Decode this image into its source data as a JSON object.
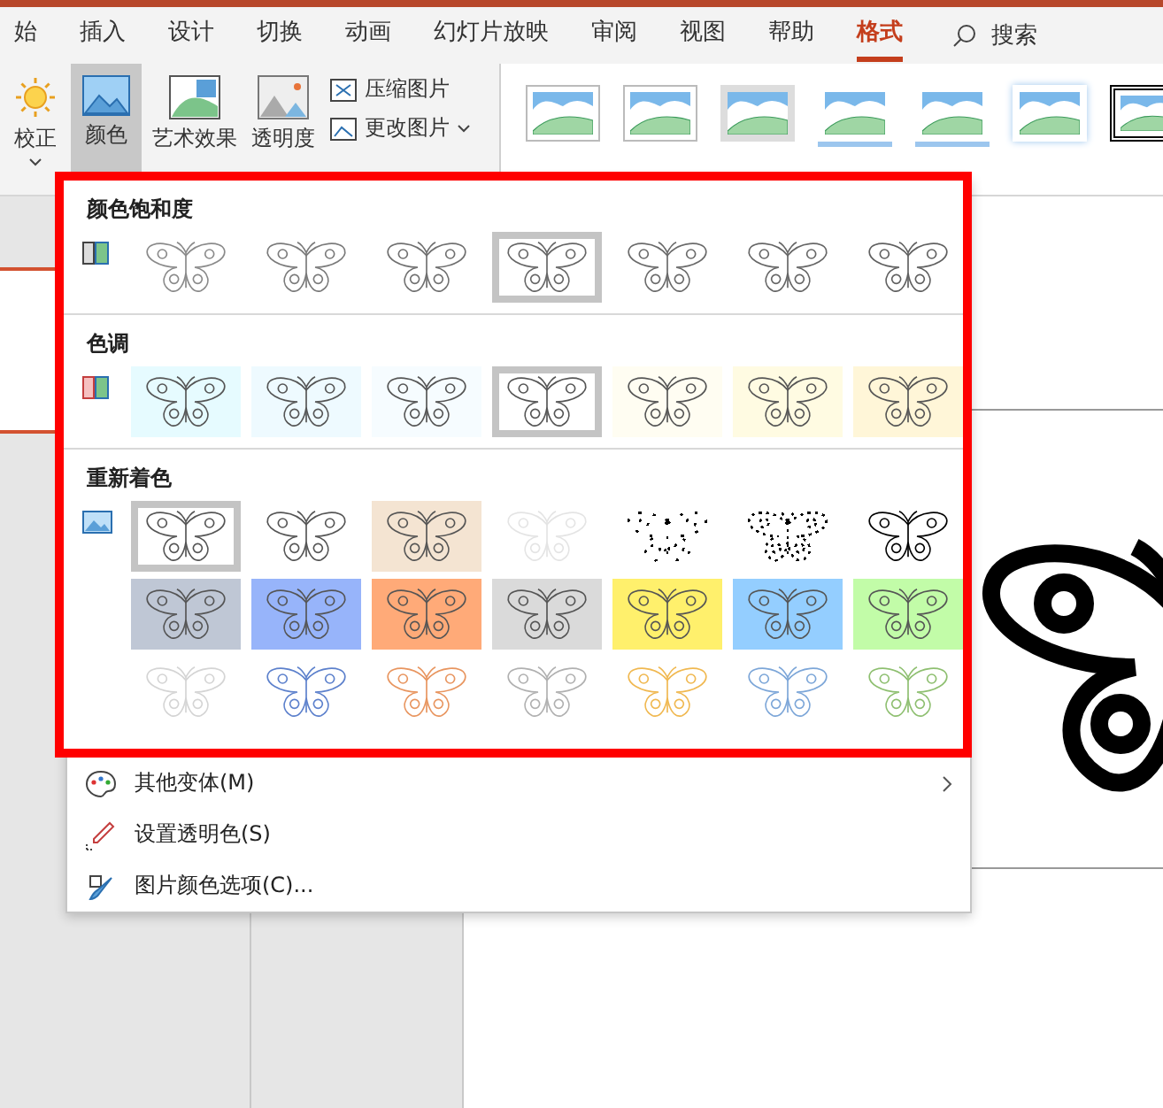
{
  "tabs": [
    {
      "label": "始",
      "selected": false
    },
    {
      "label": "插入",
      "selected": false
    },
    {
      "label": "设计",
      "selected": false
    },
    {
      "label": "切换",
      "selected": false
    },
    {
      "label": "动画",
      "selected": false
    },
    {
      "label": "幻灯片放映",
      "selected": false
    },
    {
      "label": "审阅",
      "selected": false
    },
    {
      "label": "视图",
      "selected": false
    },
    {
      "label": "帮助",
      "selected": false
    },
    {
      "label": "格式",
      "selected": true
    }
  ],
  "search": {
    "label": "搜索"
  },
  "ribbon": {
    "large_buttons": [
      {
        "label": "校正",
        "selected": false,
        "has_menu": true
      },
      {
        "label": "颜色",
        "selected": true,
        "has_menu": false
      },
      {
        "label": "艺术效果",
        "selected": false,
        "has_menu": false
      },
      {
        "label": "透明度",
        "selected": false,
        "has_menu": false
      }
    ],
    "small_buttons": [
      {
        "label": "压缩图片",
        "has_menu": false
      },
      {
        "label": "更改图片",
        "has_menu": true
      }
    ],
    "styles": [
      {
        "kind": "frame"
      },
      {
        "kind": "frame"
      },
      {
        "kind": "shadow"
      },
      {
        "kind": "soft"
      },
      {
        "kind": "soft"
      },
      {
        "kind": "glow"
      },
      {
        "kind": "double"
      }
    ]
  },
  "color_menu": {
    "sections": [
      {
        "title": "颜色饱和度",
        "rows": [
          [
            {
              "color": "#8a8a8a",
              "kind": "outline",
              "selected": false
            },
            {
              "color": "#7a7a7a",
              "kind": "outline",
              "selected": false
            },
            {
              "color": "#707070",
              "kind": "outline",
              "selected": false
            },
            {
              "color": "#666666",
              "kind": "outline",
              "selected": true
            },
            {
              "color": "#6a6a6a",
              "kind": "outline",
              "selected": false
            },
            {
              "color": "#666666",
              "kind": "outline",
              "selected": false
            },
            {
              "color": "#606060",
              "kind": "outline",
              "selected": false
            }
          ]
        ]
      },
      {
        "title": "色调",
        "rows": [
          [
            {
              "color": "#e6fbff",
              "kind": "fill",
              "selected": false
            },
            {
              "color": "#eefaff",
              "kind": "fill",
              "selected": false
            },
            {
              "color": "#f6fcff",
              "kind": "fill",
              "selected": false
            },
            {
              "color": "#ffffff",
              "kind": "fill",
              "selected": true
            },
            {
              "color": "#fffdf2",
              "kind": "fill",
              "selected": false
            },
            {
              "color": "#fffbe2",
              "kind": "fill",
              "selected": false
            },
            {
              "color": "#fff6d8",
              "kind": "fill",
              "selected": false
            }
          ]
        ]
      },
      {
        "title": "重新着色",
        "rows": [
          [
            {
              "color": "#ffffff",
              "kind": "fill",
              "selected": true
            },
            {
              "color": "#ffffff",
              "kind": "fill",
              "selected": false
            },
            {
              "color": "#f4e4d2",
              "kind": "fill",
              "selected": false
            },
            {
              "color": "#e4e4e4",
              "kind": "outline",
              "selected": false
            },
            {
              "color": "#000000",
              "kind": "sparse",
              "selected": false
            },
            {
              "color": "#000000",
              "kind": "dotted",
              "selected": false
            },
            {
              "color": "#000000",
              "kind": "outline",
              "selected": false
            }
          ],
          [
            {
              "color": "#bfc7d5",
              "kind": "fill",
              "selected": false
            },
            {
              "color": "#97b4fa",
              "kind": "fill",
              "selected": false
            },
            {
              "color": "#ffaa78",
              "kind": "fill",
              "selected": false
            },
            {
              "color": "#dadada",
              "kind": "fill",
              "selected": false
            },
            {
              "color": "#fff06c",
              "kind": "fill",
              "selected": false
            },
            {
              "color": "#94ceff",
              "kind": "fill",
              "selected": false
            },
            {
              "color": "#c2fca8",
              "kind": "fill",
              "selected": false
            }
          ],
          [
            {
              "color": "#d4d4d4",
              "kind": "outline",
              "selected": false
            },
            {
              "color": "#5c80cc",
              "kind": "outline",
              "selected": false
            },
            {
              "color": "#e8955f",
              "kind": "outline",
              "selected": false
            },
            {
              "color": "#b0b0b0",
              "kind": "outline",
              "selected": false
            },
            {
              "color": "#f0b850",
              "kind": "outline",
              "selected": false
            },
            {
              "color": "#7ca6d8",
              "kind": "outline",
              "selected": false
            },
            {
              "color": "#8ebf70",
              "kind": "outline",
              "selected": false
            }
          ]
        ]
      }
    ],
    "items": [
      {
        "label": "其他变体(M)",
        "has_submenu": true
      },
      {
        "label": "设置透明色(S)",
        "has_submenu": false
      },
      {
        "label": "图片颜色选项(C)...",
        "has_submenu": false
      }
    ]
  }
}
